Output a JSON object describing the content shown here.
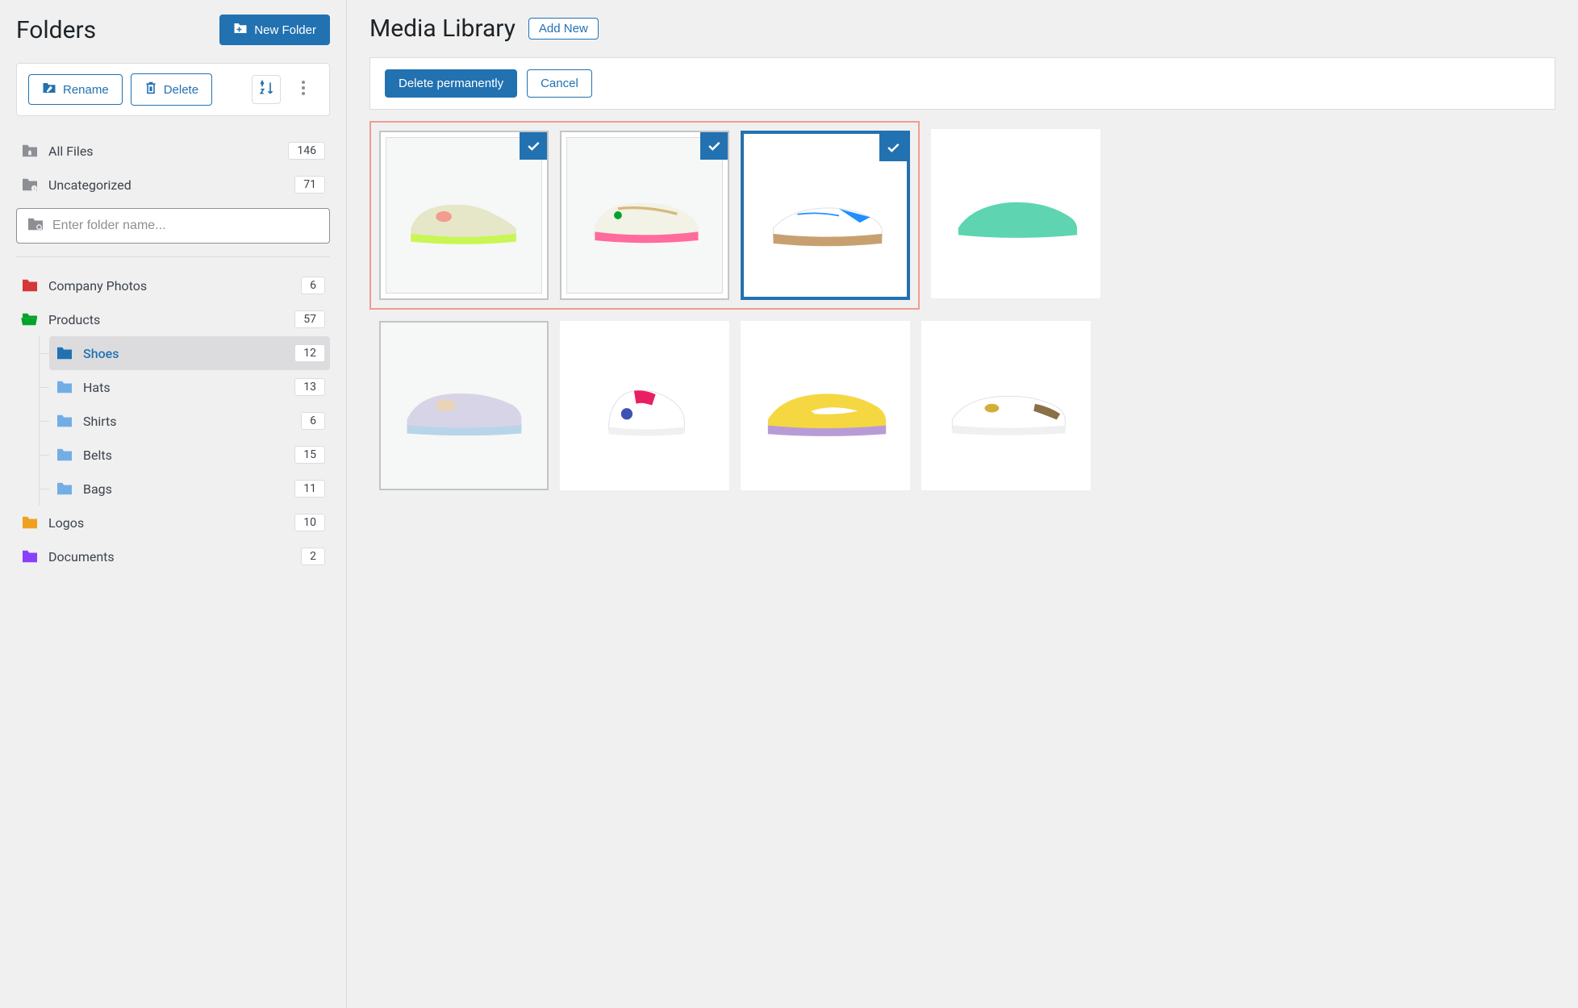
{
  "sidebar": {
    "title": "Folders",
    "new_folder_label": "New Folder",
    "rename_label": "Rename",
    "delete_label": "Delete",
    "all_files": {
      "label": "All Files",
      "count": "146"
    },
    "uncategorized": {
      "label": "Uncategorized",
      "count": "71"
    },
    "search_placeholder": "Enter folder name...",
    "tree": [
      {
        "label": "Company Photos",
        "count": "6",
        "color": "#d63638"
      },
      {
        "label": "Products",
        "count": "57",
        "color": "#00a32a",
        "open": true,
        "children": [
          {
            "label": "Shoes",
            "count": "12",
            "active": true
          },
          {
            "label": "Hats",
            "count": "13"
          },
          {
            "label": "Shirts",
            "count": "6"
          },
          {
            "label": "Belts",
            "count": "15"
          },
          {
            "label": "Bags",
            "count": "11"
          }
        ]
      },
      {
        "label": "Logos",
        "count": "10",
        "color": "#f0a020"
      },
      {
        "label": "Documents",
        "count": "2",
        "color": "#8a3ffc"
      }
    ]
  },
  "main": {
    "title": "Media Library",
    "add_new_label": "Add New",
    "delete_permanently_label": "Delete permanently",
    "cancel_label": "Cancel",
    "items": [
      {
        "name": "shoe-lime",
        "selected": true,
        "colors": [
          "#e6e6c8",
          "#c8f654",
          "#f29b8f"
        ]
      },
      {
        "name": "shoe-pink-gold",
        "selected": true,
        "colors": [
          "#f2f2e6",
          "#d6b97a",
          "#ff6b9d"
        ]
      },
      {
        "name": "shoe-blue-gum",
        "selected": true,
        "colors": [
          "#ffffff",
          "#1e90ff",
          "#c8a070",
          "#e0c080"
        ]
      },
      {
        "name": "shoe-mint",
        "selected": false,
        "colors": [
          "#5fd4b1",
          "#ffffff"
        ]
      },
      {
        "name": "shoe-pastel",
        "selected": false,
        "colors": [
          "#d8d4e8",
          "#b8d4e8",
          "#e8d4b8"
        ]
      },
      {
        "name": "shoe-pink-white",
        "selected": false,
        "colors": [
          "#ffffff",
          "#e91e63",
          "#3f51b5"
        ]
      },
      {
        "name": "shoe-yellow",
        "selected": false,
        "colors": [
          "#f5d742",
          "#b89bd6",
          "#ffffff"
        ]
      },
      {
        "name": "shoe-brown-white",
        "selected": false,
        "colors": [
          "#ffffff",
          "#8b6f47",
          "#d4af37"
        ]
      }
    ]
  },
  "colors": {
    "primary": "#2271b1",
    "danger_highlight": "#f29b8f"
  }
}
